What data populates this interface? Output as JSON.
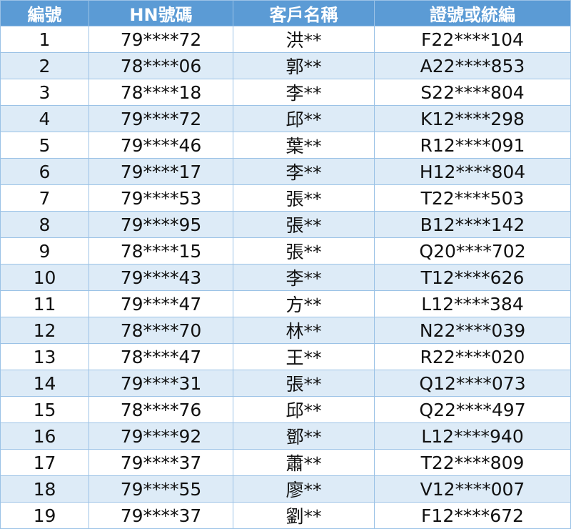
{
  "table": {
    "headers": [
      "編號",
      "HN號碼",
      "客戶名稱",
      "證號或統編"
    ],
    "rows": [
      [
        "1",
        "79****72",
        "洪**",
        "F22****104"
      ],
      [
        "2",
        "78****06",
        "郭**",
        "A22****853"
      ],
      [
        "3",
        "78****18",
        "李**",
        "S22****804"
      ],
      [
        "4",
        "79****72",
        "邱**",
        "K12****298"
      ],
      [
        "5",
        "79****46",
        "葉**",
        "R12****091"
      ],
      [
        "6",
        "79****17",
        "李**",
        "H12****804"
      ],
      [
        "7",
        "79****53",
        "張**",
        "T22****503"
      ],
      [
        "8",
        "79****95",
        "張**",
        "B12****142"
      ],
      [
        "9",
        "78****15",
        "張**",
        "Q20****702"
      ],
      [
        "10",
        "79****43",
        "李**",
        "T12****626"
      ],
      [
        "11",
        "79****47",
        "方**",
        "L12****384"
      ],
      [
        "12",
        "78****70",
        "林**",
        "N22****039"
      ],
      [
        "13",
        "78****47",
        "王**",
        "R22****020"
      ],
      [
        "14",
        "79****31",
        "張**",
        "Q12****073"
      ],
      [
        "15",
        "78****76",
        "邱**",
        "Q22****497"
      ],
      [
        "16",
        "79****92",
        "鄧**",
        "L12****940"
      ],
      [
        "17",
        "79****37",
        "蕭**",
        "T22****809"
      ],
      [
        "18",
        "79****55",
        "廖**",
        "V12****007"
      ],
      [
        "19",
        "79****37",
        "劉**",
        "F12****672"
      ]
    ]
  },
  "colors": {
    "header_bg": "#5b9bd5",
    "header_text": "#ffffff",
    "row_alt_bg": "#ddebf7",
    "border": "#9bc2e6"
  }
}
